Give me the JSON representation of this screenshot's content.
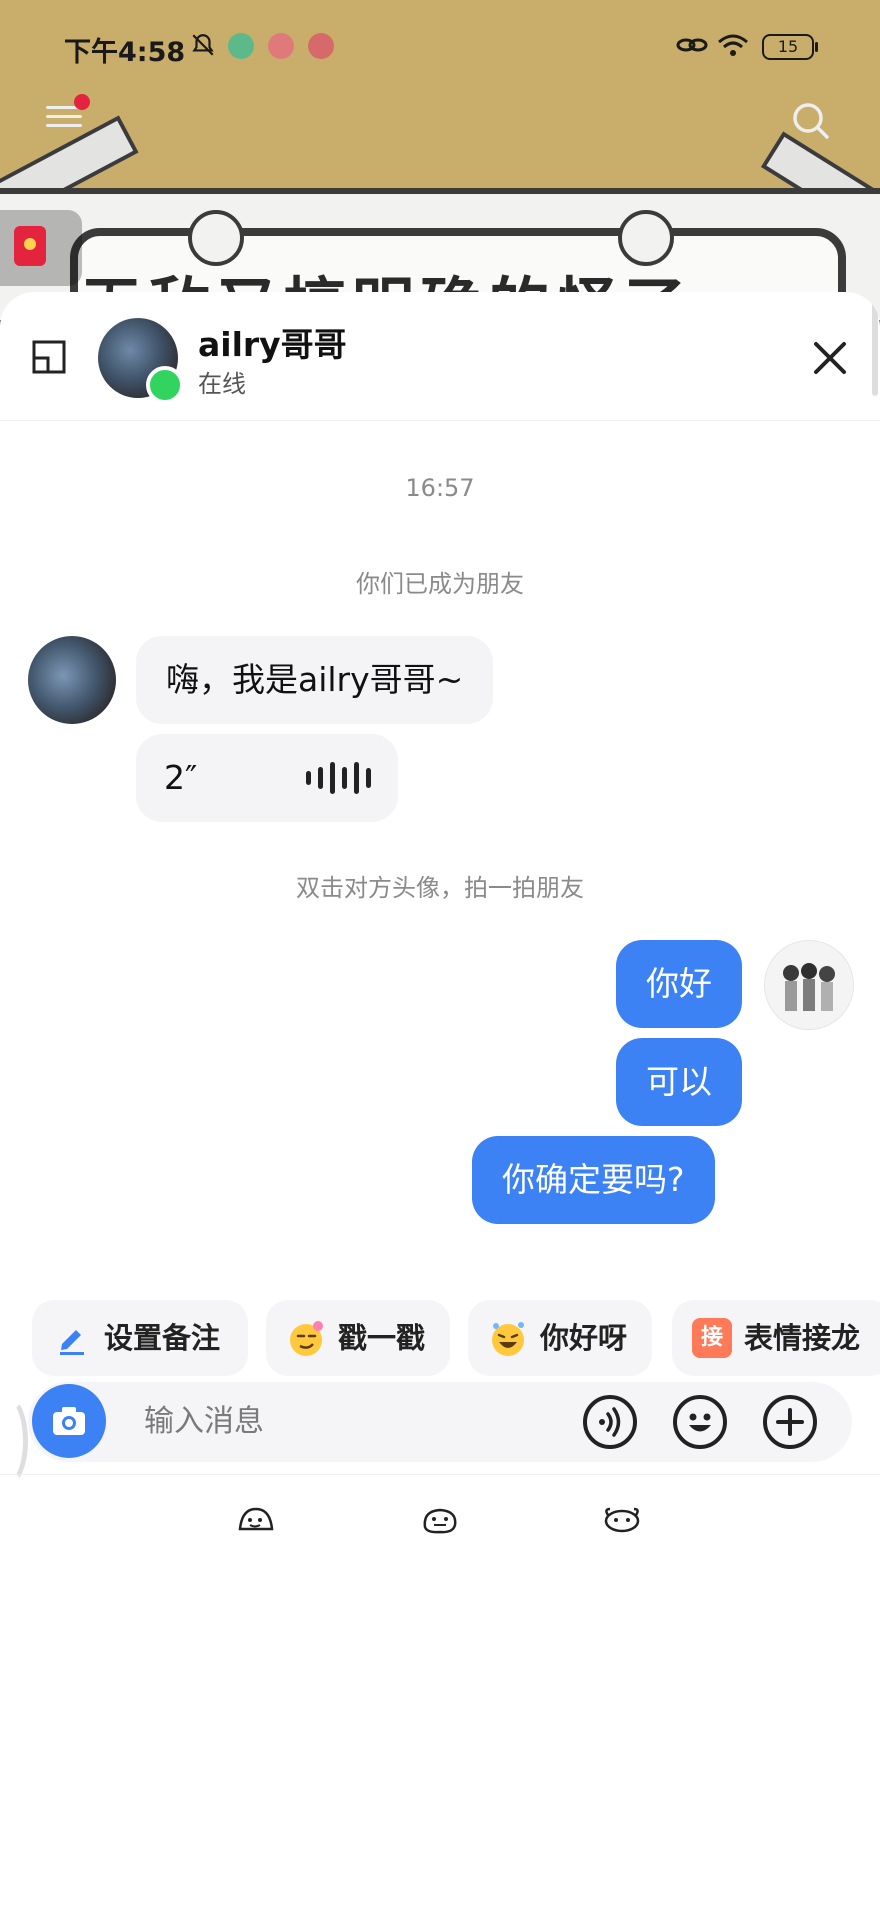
{
  "status_bar": {
    "time": "下午4:58",
    "battery": "15"
  },
  "chat": {
    "contact_name": "ailry哥哥",
    "contact_status": "在线",
    "timestamp": "16:57",
    "system_became_friends": "你们已成为朋友",
    "incoming_text": "嗨，我是ailry哥哥~",
    "voice_duration": "2″",
    "system_pat_hint": "双击对方头像，拍一拍朋友",
    "outgoing_messages": [
      "你好",
      "可以",
      "你确定要吗?"
    ]
  },
  "quick_actions": [
    "设置备注",
    "戳一戳",
    "你好呀",
    "表情接龙"
  ],
  "quick_action_badge": "接",
  "input": {
    "placeholder": "输入消息"
  },
  "background_video_text": "无敌又搞明确的怪了",
  "colors": {
    "bubble_outgoing": "#3d82f4",
    "bubble_incoming": "#f4f4f6",
    "online": "#31d45f",
    "notification_dot": "#e4243f"
  },
  "icons": [
    "menu-icon",
    "search-icon",
    "red-packet-icon",
    "window-mode-icon",
    "close-icon",
    "camera-icon",
    "voice-icon",
    "emoji-icon",
    "plus-icon",
    "pencil-icon"
  ]
}
